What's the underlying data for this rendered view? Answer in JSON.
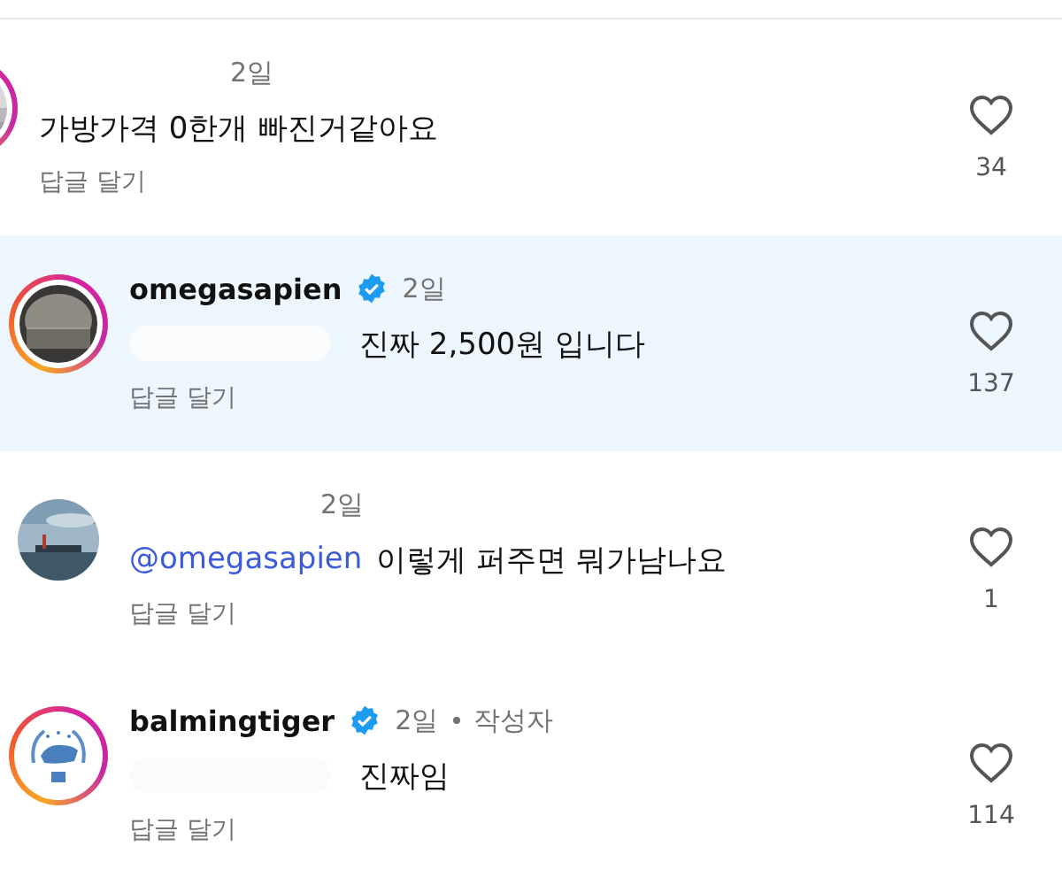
{
  "comments": [
    {
      "avatar": {
        "kind": "cut",
        "ring": true
      },
      "time": "2일",
      "text": "가방가격 0한개 빠진거같아요",
      "reply": "답글 달기",
      "likes": "34",
      "highlighted": false,
      "hidden_prefix": false
    },
    {
      "avatar": {
        "kind": "dark-photo",
        "ring": true
      },
      "username": "omegasapien",
      "verified": true,
      "time": "2일",
      "text": "진짜 2,500원 입니다",
      "reply": "답글 달기",
      "likes": "137",
      "highlighted": true,
      "hidden_prefix": true
    },
    {
      "avatar": {
        "kind": "sea-photo",
        "ring": false
      },
      "time": "2일",
      "mention": "@omegasapien",
      "text": "이렇게 퍼주면 뭐가남나요",
      "reply": "답글 달기",
      "likes": "1",
      "highlighted": false,
      "hidden_prefix": false
    },
    {
      "avatar": {
        "kind": "emblem",
        "ring": true
      },
      "username": "balmingtiger",
      "verified": true,
      "time": "2일",
      "author_label": "작성자",
      "text": "진짜임",
      "reply": "답글 달기",
      "likes": "114",
      "highlighted": false,
      "hidden_prefix": true
    }
  ]
}
